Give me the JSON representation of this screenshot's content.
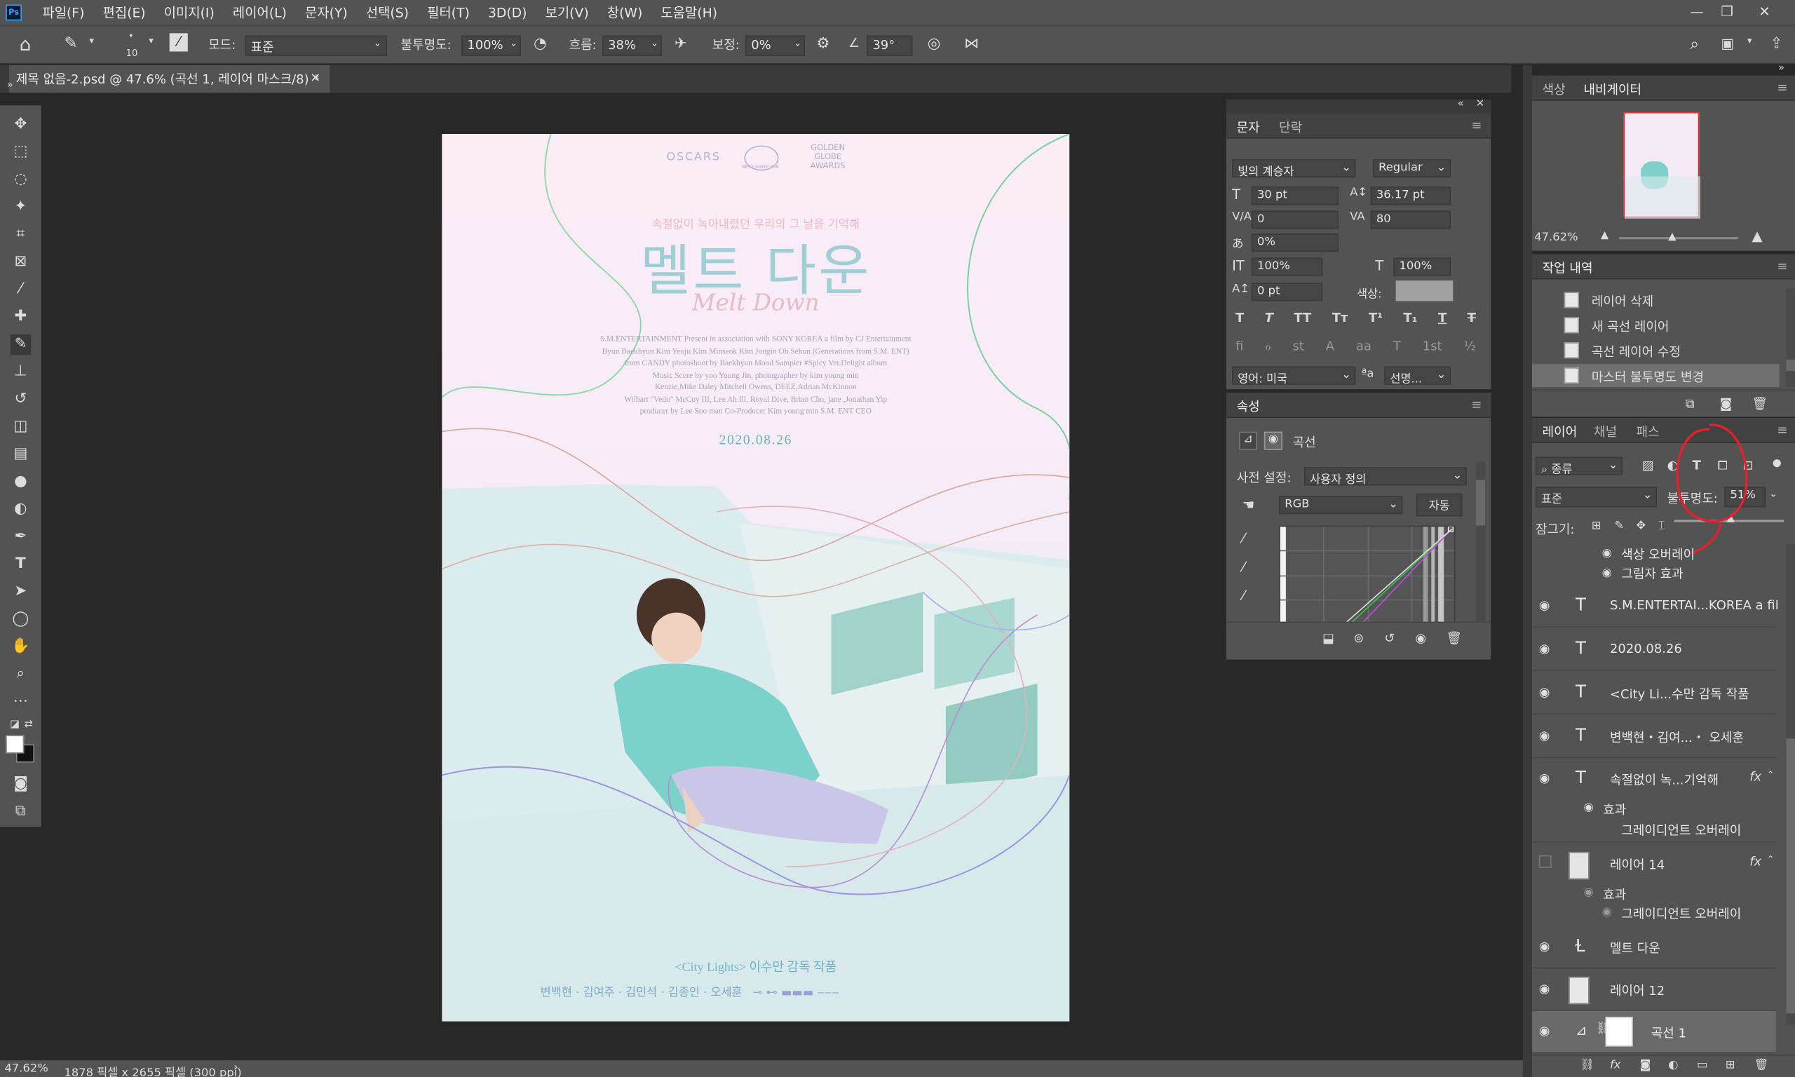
{
  "menubar": {
    "app_icon": "Ps",
    "items": [
      "파일(F)",
      "편집(E)",
      "이미지(I)",
      "레이어(L)",
      "문자(Y)",
      "선택(S)",
      "필터(T)",
      "3D(D)",
      "보기(V)",
      "창(W)",
      "도움말(H)"
    ]
  },
  "options": {
    "brush_size": "10",
    "mode_label": "모드:",
    "mode_value": "표준",
    "opacity_label": "불투명도:",
    "opacity_value": "100%",
    "flow_label": "흐름:",
    "flow_value": "38%",
    "smoothing_label": "보정:",
    "smoothing_value": "0%",
    "angle_value": "39°"
  },
  "document": {
    "tab_title": "제목 없음-2.psd @ 47.6% (곡선 1, 레이어 마스크/8) *",
    "zoom": "47.62%",
    "dimensions": "1878 픽셀 x 2655 픽셀 (300 ppi)"
  },
  "poster": {
    "logos": [
      "OSCARS",
      "BEST DIRECTOR",
      "GOLDEN GLOBE AWARDS"
    ],
    "tagline": "속절없이 녹아내렸던 우리의 그 날을 기억해",
    "title": "멜트 다운",
    "script_title": "Melt Down",
    "credits": [
      "S.M.ENTERTAINMENT Present in association with SONY KOREA a film by CJ Entertainment",
      "Byun Baekhyun Kim Yeoju Kim Minseok Kim Jongin Oh Sehun (Generations from S.M. ENT)",
      "from CANDY photoshoot by Baekhyun Mood Sampler #Spicy Ver.Delight album",
      "Music Score by yoo Young Jin, photographer by kim young min",
      "Kenzie,Mike Daley Mitchell Owens, DEEZ,Adrian McKinnon",
      "Wilbart \"Vedo\" McCoy III, Lee Ah Ill, Royal Dive, Brian Cho, jane ,Jonathan Yip",
      "producer by Lee Soo man Co-Producer Kim young min S.M. ENT CEO"
    ],
    "date": "2020.08.26",
    "director": "<City Lights> 이수만 감독 작품",
    "cast": [
      "변백현",
      "김여주",
      "김민석",
      "김종인",
      "오세훈"
    ]
  },
  "character_panel": {
    "tabs": [
      "문자",
      "단락"
    ],
    "font_family": "빛의 계승자",
    "font_style": "Regular",
    "size": "30 pt",
    "leading": "36.17 pt",
    "kerning": "0",
    "tracking": "80",
    "tsume": "0%",
    "vscale": "100%",
    "hscale": "100%",
    "baseline": "0 pt",
    "color_label": "색상:",
    "type_buttons": [
      "T",
      "T",
      "TT",
      "Tт",
      "T¹",
      "T₁",
      "T",
      "T"
    ],
    "ot_buttons": [
      "fi",
      "ℴ",
      "st",
      "A",
      "aa",
      "T",
      "1st",
      "½"
    ],
    "language": "영어: 미국",
    "aa_label": "ªa",
    "aa_value": "선명..."
  },
  "properties_panel": {
    "title": "속성",
    "type_label": "곡선",
    "preset_label": "사전 설정:",
    "preset_value": "사용자 정의",
    "channel_value": "RGB",
    "auto_button": "자동"
  },
  "navigator": {
    "tabs": [
      "색상",
      "내비게이터"
    ],
    "zoom": "47.62%"
  },
  "history": {
    "title": "작업 내역",
    "items": [
      "레이어 삭제",
      "새 곡선 레이어",
      "곡선 레이어 수정",
      "마스터 불투명도 변경"
    ]
  },
  "layers_panel": {
    "tabs": [
      "레이어",
      "채널",
      "패스"
    ],
    "filter_label": "종류",
    "blend_mode": "표준",
    "opacity_label": "불투명도:",
    "opacity_value": "51%",
    "lock_label": "잠그기:",
    "effects_top": [
      "색상 오버레이",
      "그림자 효과"
    ],
    "layers": [
      {
        "name": "S.M.ENTERTAI...KOREA a fil",
        "kind": "text"
      },
      {
        "name": "2020.08.26",
        "kind": "text"
      },
      {
        "name": "<City Li...수만 감독 작품",
        "kind": "text"
      },
      {
        "name": "변백현・김여...・ 오세훈",
        "kind": "text"
      },
      {
        "name": "속절없이 녹...기억해",
        "kind": "text",
        "fx": "fx"
      },
      {
        "name": "레이어 14",
        "kind": "pixel",
        "fx": "fx"
      },
      {
        "name": "멜트 다운",
        "kind": "warp"
      },
      {
        "name": "레이어 12",
        "kind": "pixel"
      },
      {
        "name": "곡선 1",
        "kind": "adjustment"
      }
    ],
    "effect_label": "효과",
    "gradient_overlay": "그레이디언트 오버레이"
  }
}
